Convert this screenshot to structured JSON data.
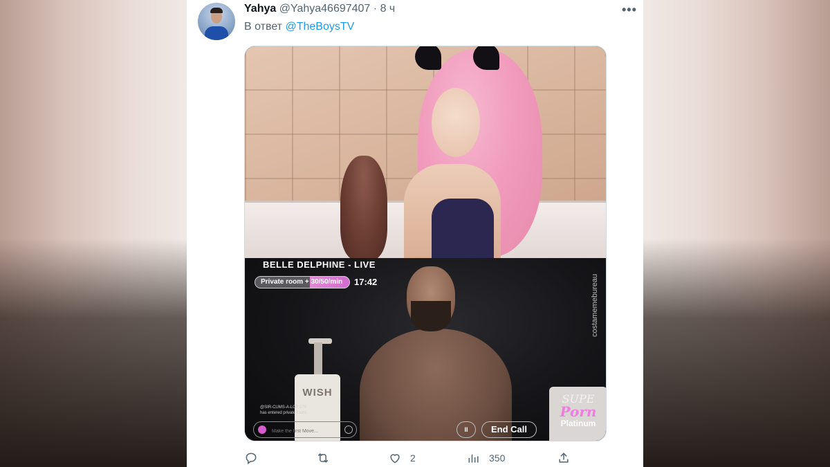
{
  "tweet": {
    "display_name": "Yahya",
    "handle": "@Yahya46697407",
    "separator": "·",
    "time": "8 ч",
    "reply_prefix": "В ответ",
    "reply_to": "@TheBoysTV",
    "more_label": "•••"
  },
  "media": {
    "stream": {
      "title": "BELLE DELPHINE  - LIVE",
      "private_room": "Private room + 30/50/min",
      "time": "17:42",
      "watermark": "costamemebureau",
      "chat_notice_line1": "@SIR-CUMS-A-LOT-178",
      "chat_notice_line2": "has entered private room.",
      "message_placeholder": "Make the first Move...",
      "pause_label": "II",
      "end_call_label": "End Call",
      "bottle_label": "WISH",
      "brand_line1": "SUPE",
      "brand_line2": "Porn",
      "brand_line3": "Platinum"
    }
  },
  "actions": {
    "reply_count": "",
    "retweet_count": "",
    "like_count": "2",
    "views_count": "350"
  },
  "colors": {
    "accent": "#1d9bf0",
    "secondary_text": "#536471",
    "primary_text": "#0f1419",
    "stream_pink": "#e489d6"
  },
  "icons": [
    "reply-icon",
    "retweet-icon",
    "like-icon",
    "views-icon",
    "share-icon",
    "more-icon"
  ]
}
